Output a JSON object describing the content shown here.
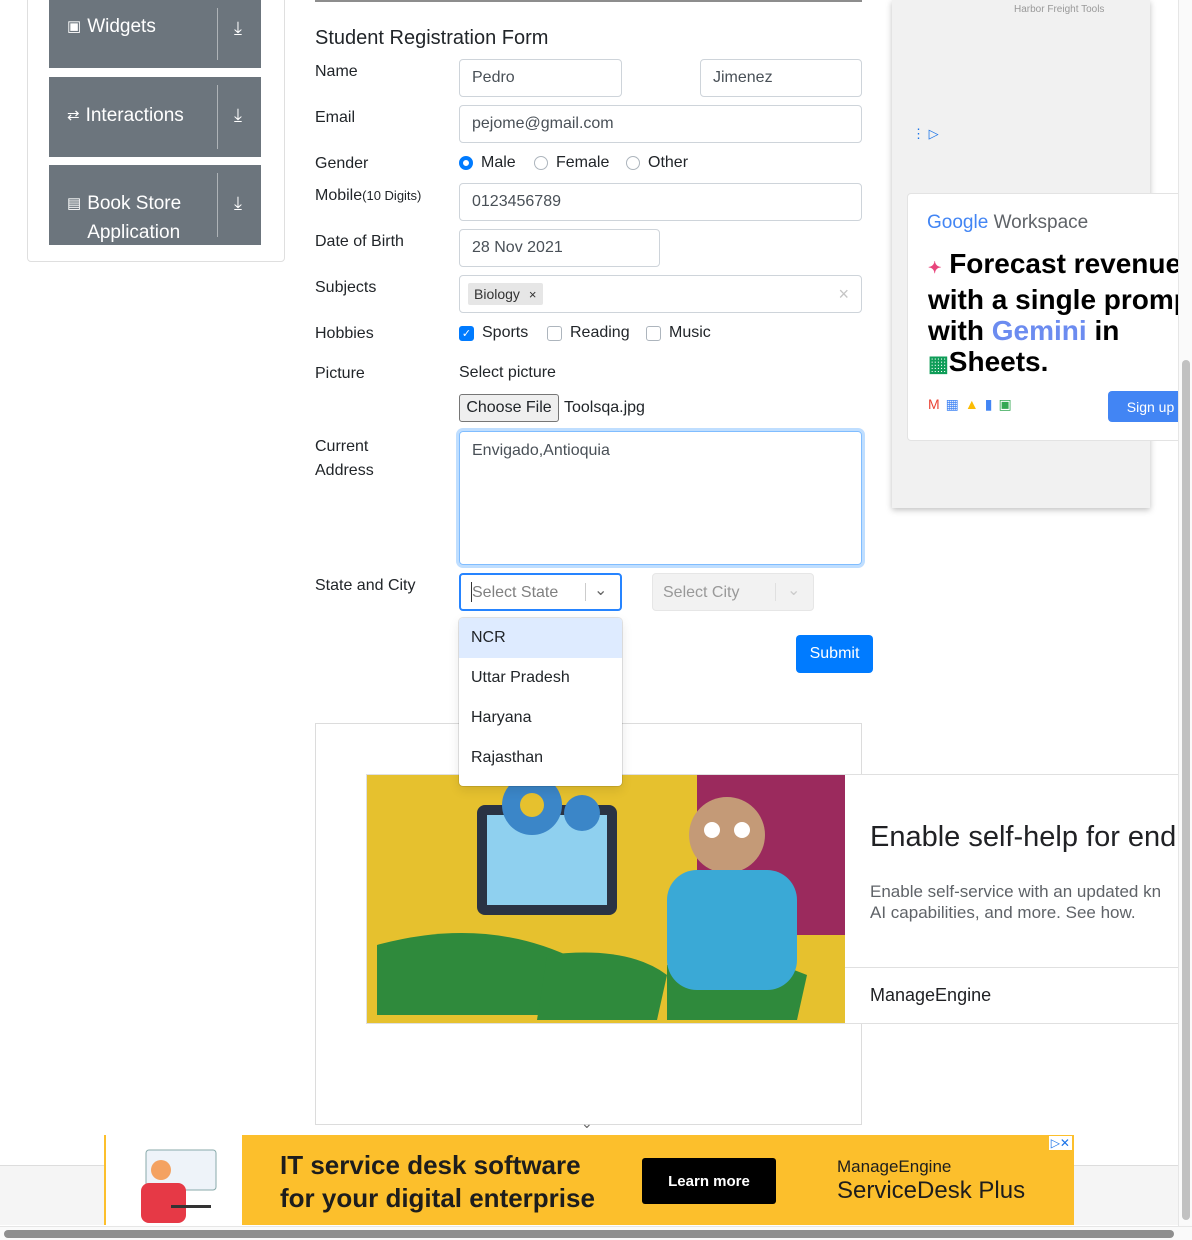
{
  "sidebar": {
    "items": [
      {
        "label": "Widgets",
        "icon": "widgets-icon"
      },
      {
        "label": "Interactions",
        "icon": "interactions-icon"
      },
      {
        "label": "Book Store Application",
        "label_line1": "Book Store",
        "label_line2": "Application",
        "icon": "book-store-icon"
      }
    ]
  },
  "form": {
    "title": "Student Registration Form",
    "name_label": "Name",
    "first_name": "Pedro",
    "last_name": "Jimenez",
    "email_label": "Email",
    "email": "pejome@gmail.com",
    "gender_label": "Gender",
    "genders": [
      "Male",
      "Female",
      "Other"
    ],
    "gender_selected": "Male",
    "mobile_label": "Mobile",
    "mobile_hint": "(10 Digits)",
    "mobile": "0123456789",
    "dob_label": "Date of Birth",
    "dob": "28 Nov 2021",
    "subjects_label": "Subjects",
    "subject_tag": "Biology",
    "hobbies_label": "Hobbies",
    "hobbies": [
      {
        "label": "Sports",
        "checked": true
      },
      {
        "label": "Reading",
        "checked": false
      },
      {
        "label": "Music",
        "checked": false
      }
    ],
    "picture_label": "Picture",
    "select_picture": "Select picture",
    "choose_file": "Choose File",
    "file_name": "Toolsqa.jpg",
    "address_label_1": "Current",
    "address_label_2": "Address",
    "address": "Envigado,Antioquia",
    "state_city_label": "State and City",
    "state_placeholder": "Select State",
    "city_placeholder": "Select City",
    "state_options": [
      "NCR",
      "Uttar Pradesh",
      "Haryana",
      "Rajasthan"
    ],
    "highlighted_option": "NCR",
    "submit": "Submit"
  },
  "ads": {
    "right_top_caption": "Harbor Freight Tools",
    "google_brand": "Google",
    "google_product": "Workspace",
    "headline_1": "Forecast revenue",
    "headline_2": "with a single promp",
    "headline_3_pre": "with",
    "headline_3_gemini": "Gemini",
    "headline_3_post": "in",
    "headline_4": "Sheets.",
    "signup": "Sign up",
    "mid_title": "Enable self-help for end",
    "mid_body_1": "Enable self-service with an updated kn",
    "mid_body_2": "AI capabilities, and more. See how.",
    "mid_brand": "ManageEngine",
    "bottom_line_1": "IT service desk software",
    "bottom_line_2": "for your digital enterprise",
    "learn_more": "Learn more",
    "bottom_brand_1": "ManageEngine",
    "bottom_brand_2": "ServiceDesk Plus"
  },
  "colors": {
    "primary": "#007bff",
    "sidebar": "#6c757d",
    "ad_yellow": "#fcbf2c",
    "gemini": "#6c8cf0"
  }
}
